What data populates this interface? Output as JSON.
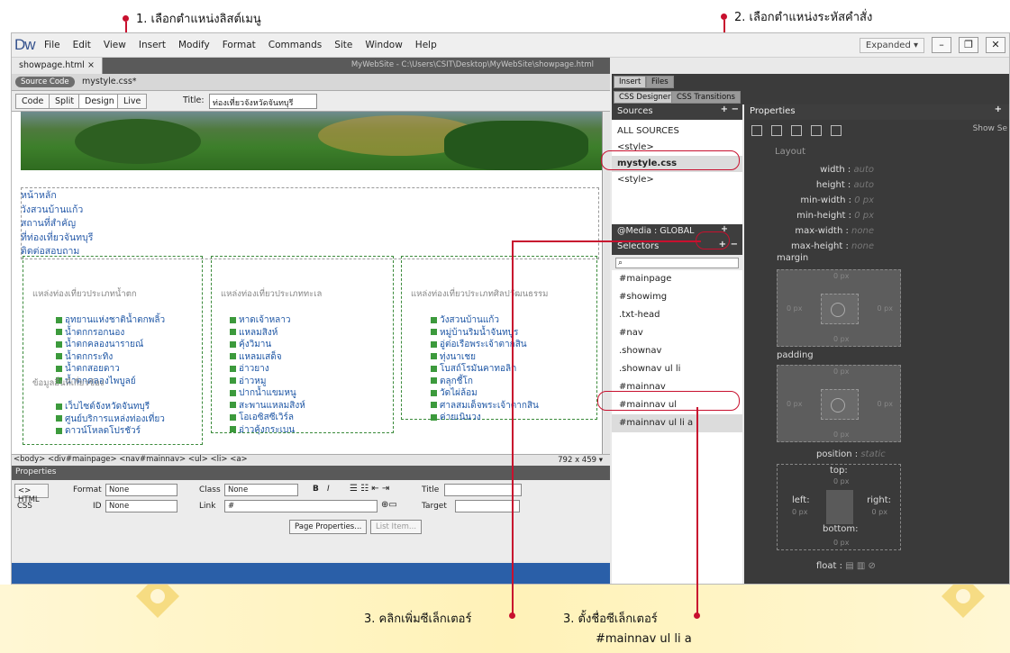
{
  "callouts": {
    "c1": "1. เลือกตำแหน่งลิสต์เมนู",
    "c2": "2. เลือกตำแหน่งระหัสคำสั่ง",
    "c3a": "3. คลิกเพิ่มซีเล็กเตอร์",
    "c3b_line1": "3. ตั้งชื่อซีเล็กเตอร์",
    "c3b_line2": "#mainnav ul li a"
  },
  "app": {
    "logo": "Dw",
    "menus": [
      "File",
      "Edit",
      "View",
      "Insert",
      "Modify",
      "Format",
      "Commands",
      "Site",
      "Window",
      "Help"
    ],
    "workspace": "Expanded ▾",
    "doc_tab": "showpage.html ×",
    "doc_path": "MyWebSite - C:\\Users\\CSIT\\Desktop\\MyWebSite\\showpage.html",
    "source_code": "Source Code",
    "related_file": "mystyle.css*",
    "views": [
      "Code",
      "Split",
      "Design",
      "Live"
    ],
    "title_label": "Title:",
    "title_value": "ท่องเที่ยวจังหวัดจันทบุรี"
  },
  "design": {
    "nav_items": [
      "หน้าหลัก",
      "วังสวนบ้านแก้ว",
      "สถานที่สำคัญ",
      "ที่ท่องเที่ยวจันทบุรี",
      "ติดต่อสอบถาม"
    ],
    "box1": {
      "heading": "แหล่งท่องเที่ยวประเภทน้ำตก",
      "items": [
        "อุทยานแห่งชาติน้ำตกพลิ้ว",
        "น้ำตกกรอกนอง",
        "น้ำตกคลองนารายณ์",
        "น้ำตกกระทิง",
        "น้ำตกสอยดาว",
        "น้ำตกคลองไพบูลย์"
      ],
      "heading2": "ข้อมูลอื่นที่เกี่ยวข้อง",
      "items2": [
        "เว็บไซต์จังหวัดจันทบุรี",
        "ศูนย์บริการแหล่งท่องเที่ยว",
        "ดาวน์โหลดโปรชัวร์"
      ]
    },
    "box2": {
      "heading": "แหล่งท่องเที่ยวประเภททะเล",
      "items": [
        "หาดเจ้าหลาว",
        "แหลมสิงห์",
        "คุ้งวิมาน",
        "แหลมเสด็จ",
        "อ่าวยาง",
        "อ่าวหมู",
        "ปากน้ำแขมหนู",
        "สะพานแหลมสิงห์",
        "โอเอซิสซีเวิร์ล",
        "อ่าวคุ้งกระเบน"
      ]
    },
    "box3": {
      "heading": "แหล่งท่องเที่ยวประเภทศิลปวัฒนธรรม",
      "items": [
        "วังสวนบ้านแก้ว",
        "หมู่บ้านริมน้ำจันทบูร",
        "อู่ต่อเรือพระเจ้าตากสิน",
        "ทุ่งนาเชย",
        "โบสถ์โรมันคาทอลิก",
        "ตลุกชี้โก",
        "วัดไผ่ล้อม",
        "ศาลสมเด็จพระเจ้าตากสิน",
        "ค่ายเนินวง"
      ]
    }
  },
  "tagbar": {
    "path": "<body> <div#mainpage> <nav#mainnav> <ul> <li> <a>",
    "size": "792 x 459 ▾"
  },
  "properties": {
    "title": "Properties",
    "html": "<> HTML",
    "css": "CSS",
    "format_label": "Format",
    "format_value": "None",
    "id_label": "ID",
    "id_value": "None",
    "class_label": "Class",
    "class_value": "None",
    "link_label": "Link",
    "link_value": "#",
    "title_label": "Title",
    "target_label": "Target",
    "page_props": "Page Properties...",
    "list_item": "List Item..."
  },
  "panels": {
    "tab_insert": "Insert",
    "tab_files": "Files",
    "tab_css_designer": "CSS Designer",
    "tab_css_transitions": "CSS Transitions",
    "sources_head": "Sources",
    "sources": [
      "ALL SOURCES",
      "<style>",
      "mystyle.css",
      "<style>"
    ],
    "media_head": "@Media : GLOBAL",
    "selectors_head": "Selectors",
    "selectors": [
      "#mainpage",
      "#showimg",
      ".txt-head",
      "#nav",
      ".shownav",
      ".shownav ul li",
      "#mainnav",
      "#mainnav ul",
      "#mainnav ul li a"
    ],
    "properties_head": "Properties",
    "show_set": "Show Se",
    "layout": "Layout",
    "layout_props": [
      {
        "name": "width",
        "value": "auto"
      },
      {
        "name": "height",
        "value": "auto"
      },
      {
        "name": "min-width",
        "value": "0 px"
      },
      {
        "name": "min-height",
        "value": "0 px"
      },
      {
        "name": "max-width",
        "value": "none"
      },
      {
        "name": "max-height",
        "value": "none"
      }
    ],
    "margin": "margin",
    "padding": "padding",
    "zero": "0 px",
    "position_label": "position",
    "position_value": "static",
    "top": "top:",
    "left": "left:",
    "right": "right:",
    "bottom": "bottom:",
    "float": "float"
  }
}
